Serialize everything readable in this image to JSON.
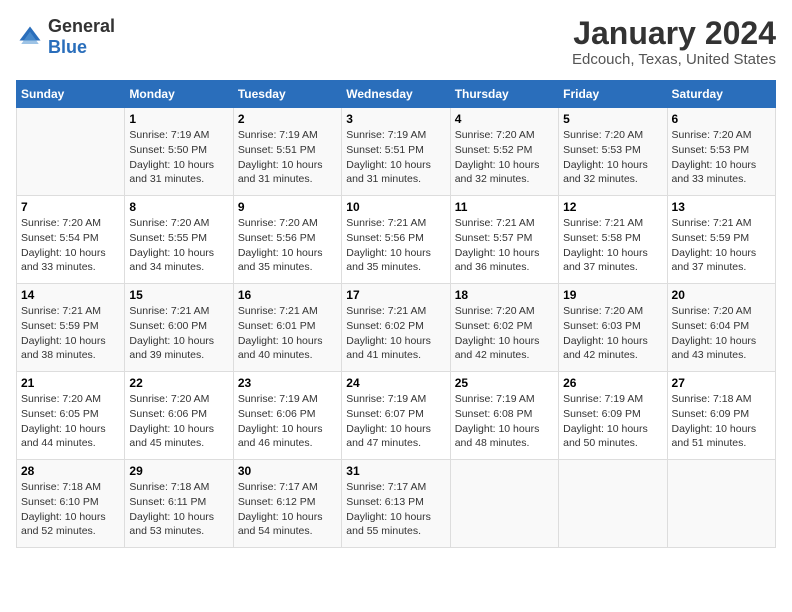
{
  "header": {
    "logo_general": "General",
    "logo_blue": "Blue",
    "main_title": "January 2024",
    "subtitle": "Edcouch, Texas, United States"
  },
  "calendar": {
    "weekdays": [
      "Sunday",
      "Monday",
      "Tuesday",
      "Wednesday",
      "Thursday",
      "Friday",
      "Saturday"
    ],
    "weeks": [
      [
        {
          "day": "",
          "detail": ""
        },
        {
          "day": "1",
          "detail": "Sunrise: 7:19 AM\nSunset: 5:50 PM\nDaylight: 10 hours\nand 31 minutes."
        },
        {
          "day": "2",
          "detail": "Sunrise: 7:19 AM\nSunset: 5:51 PM\nDaylight: 10 hours\nand 31 minutes."
        },
        {
          "day": "3",
          "detail": "Sunrise: 7:19 AM\nSunset: 5:51 PM\nDaylight: 10 hours\nand 31 minutes."
        },
        {
          "day": "4",
          "detail": "Sunrise: 7:20 AM\nSunset: 5:52 PM\nDaylight: 10 hours\nand 32 minutes."
        },
        {
          "day": "5",
          "detail": "Sunrise: 7:20 AM\nSunset: 5:53 PM\nDaylight: 10 hours\nand 32 minutes."
        },
        {
          "day": "6",
          "detail": "Sunrise: 7:20 AM\nSunset: 5:53 PM\nDaylight: 10 hours\nand 33 minutes."
        }
      ],
      [
        {
          "day": "7",
          "detail": "Sunrise: 7:20 AM\nSunset: 5:54 PM\nDaylight: 10 hours\nand 33 minutes."
        },
        {
          "day": "8",
          "detail": "Sunrise: 7:20 AM\nSunset: 5:55 PM\nDaylight: 10 hours\nand 34 minutes."
        },
        {
          "day": "9",
          "detail": "Sunrise: 7:20 AM\nSunset: 5:56 PM\nDaylight: 10 hours\nand 35 minutes."
        },
        {
          "day": "10",
          "detail": "Sunrise: 7:21 AM\nSunset: 5:56 PM\nDaylight: 10 hours\nand 35 minutes."
        },
        {
          "day": "11",
          "detail": "Sunrise: 7:21 AM\nSunset: 5:57 PM\nDaylight: 10 hours\nand 36 minutes."
        },
        {
          "day": "12",
          "detail": "Sunrise: 7:21 AM\nSunset: 5:58 PM\nDaylight: 10 hours\nand 37 minutes."
        },
        {
          "day": "13",
          "detail": "Sunrise: 7:21 AM\nSunset: 5:59 PM\nDaylight: 10 hours\nand 37 minutes."
        }
      ],
      [
        {
          "day": "14",
          "detail": "Sunrise: 7:21 AM\nSunset: 5:59 PM\nDaylight: 10 hours\nand 38 minutes."
        },
        {
          "day": "15",
          "detail": "Sunrise: 7:21 AM\nSunset: 6:00 PM\nDaylight: 10 hours\nand 39 minutes."
        },
        {
          "day": "16",
          "detail": "Sunrise: 7:21 AM\nSunset: 6:01 PM\nDaylight: 10 hours\nand 40 minutes."
        },
        {
          "day": "17",
          "detail": "Sunrise: 7:21 AM\nSunset: 6:02 PM\nDaylight: 10 hours\nand 41 minutes."
        },
        {
          "day": "18",
          "detail": "Sunrise: 7:20 AM\nSunset: 6:02 PM\nDaylight: 10 hours\nand 42 minutes."
        },
        {
          "day": "19",
          "detail": "Sunrise: 7:20 AM\nSunset: 6:03 PM\nDaylight: 10 hours\nand 42 minutes."
        },
        {
          "day": "20",
          "detail": "Sunrise: 7:20 AM\nSunset: 6:04 PM\nDaylight: 10 hours\nand 43 minutes."
        }
      ],
      [
        {
          "day": "21",
          "detail": "Sunrise: 7:20 AM\nSunset: 6:05 PM\nDaylight: 10 hours\nand 44 minutes."
        },
        {
          "day": "22",
          "detail": "Sunrise: 7:20 AM\nSunset: 6:06 PM\nDaylight: 10 hours\nand 45 minutes."
        },
        {
          "day": "23",
          "detail": "Sunrise: 7:19 AM\nSunset: 6:06 PM\nDaylight: 10 hours\nand 46 minutes."
        },
        {
          "day": "24",
          "detail": "Sunrise: 7:19 AM\nSunset: 6:07 PM\nDaylight: 10 hours\nand 47 minutes."
        },
        {
          "day": "25",
          "detail": "Sunrise: 7:19 AM\nSunset: 6:08 PM\nDaylight: 10 hours\nand 48 minutes."
        },
        {
          "day": "26",
          "detail": "Sunrise: 7:19 AM\nSunset: 6:09 PM\nDaylight: 10 hours\nand 50 minutes."
        },
        {
          "day": "27",
          "detail": "Sunrise: 7:18 AM\nSunset: 6:09 PM\nDaylight: 10 hours\nand 51 minutes."
        }
      ],
      [
        {
          "day": "28",
          "detail": "Sunrise: 7:18 AM\nSunset: 6:10 PM\nDaylight: 10 hours\nand 52 minutes."
        },
        {
          "day": "29",
          "detail": "Sunrise: 7:18 AM\nSunset: 6:11 PM\nDaylight: 10 hours\nand 53 minutes."
        },
        {
          "day": "30",
          "detail": "Sunrise: 7:17 AM\nSunset: 6:12 PM\nDaylight: 10 hours\nand 54 minutes."
        },
        {
          "day": "31",
          "detail": "Sunrise: 7:17 AM\nSunset: 6:13 PM\nDaylight: 10 hours\nand 55 minutes."
        },
        {
          "day": "",
          "detail": ""
        },
        {
          "day": "",
          "detail": ""
        },
        {
          "day": "",
          "detail": ""
        }
      ]
    ]
  }
}
